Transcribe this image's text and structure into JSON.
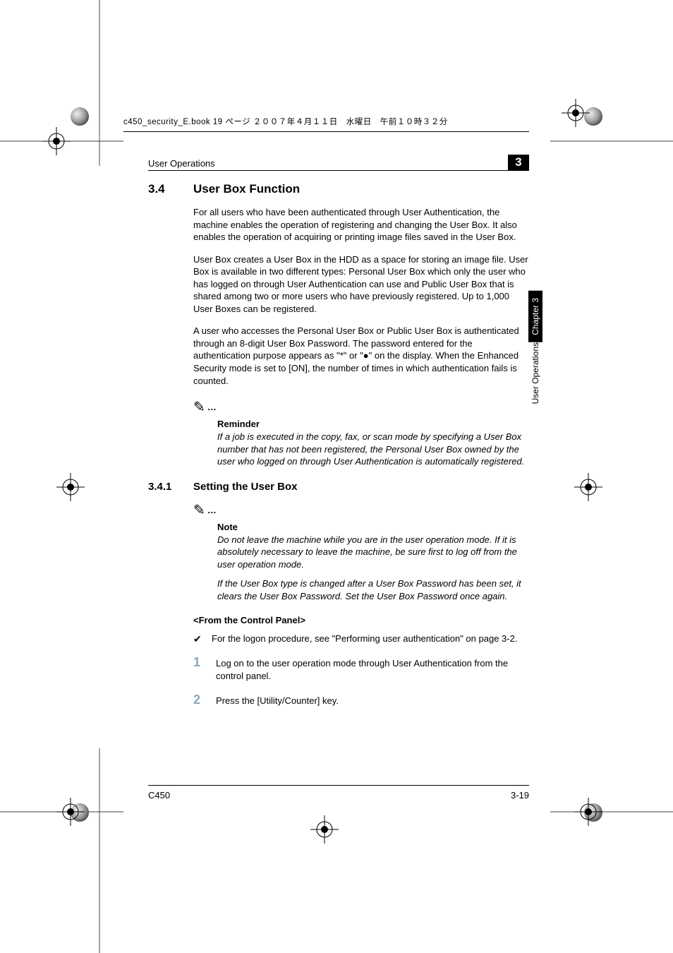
{
  "imposition_header": "c450_security_E.book  19 ページ  ２００７年４月１１日　水曜日　午前１０時３２分",
  "running_head": {
    "section": "User Operations",
    "chapter_num": "3"
  },
  "side_tab": {
    "black": "Chapter 3",
    "white": "User Operations"
  },
  "section": {
    "number": "3.4",
    "title": "User Box Function",
    "paras": [
      "For all users who have been authenticated through User Authentication, the machine enables the operation of registering and changing the User Box. It also enables the operation of acquiring or printing image files saved in the User Box.",
      "User Box creates a User Box in the HDD as a space for storing an image file. User Box is available in two different types: Personal User Box which only the user who has logged on through User Authentication can use and Public User Box that is shared among two or more users who have previously registered. Up to 1,000 User Boxes can be registered.",
      "A user who accesses the Personal User Box or Public User Box is authenticated through an 8-digit User Box Password. The password entered for the authentication purpose appears as \"*\" or \"●\" on the display. When the Enhanced Security mode is set to [ON], the number of times in which authentication fails is counted."
    ]
  },
  "reminder": {
    "head": "Reminder",
    "body": "If a job is executed in the copy, fax, or scan mode by specifying a User Box number that has not been registered, the Personal User Box owned by the user who logged on through User Authentication is automatically registered."
  },
  "subsection": {
    "number": "3.4.1",
    "title": "Setting the User Box"
  },
  "note": {
    "head": "Note",
    "body1": "Do not leave the machine while you are in the user operation mode. If it is absolutely necessary to leave the machine, be sure first to log off from the user operation mode.",
    "body2": "If the User Box type is changed after a User Box Password has been set, it clears the User Box Password. Set the User Box Password once again."
  },
  "from_panel": "<From the Control Panel>",
  "check_item": "For the logon procedure, see \"Performing user authentication\" on page 3-2.",
  "steps": [
    {
      "n": "1",
      "t": "Log on to the user operation mode through User Authentication from the control panel."
    },
    {
      "n": "2",
      "t": "Press the [Utility/Counter] key."
    }
  ],
  "footer": {
    "left": "C450",
    "right": "3-19"
  }
}
